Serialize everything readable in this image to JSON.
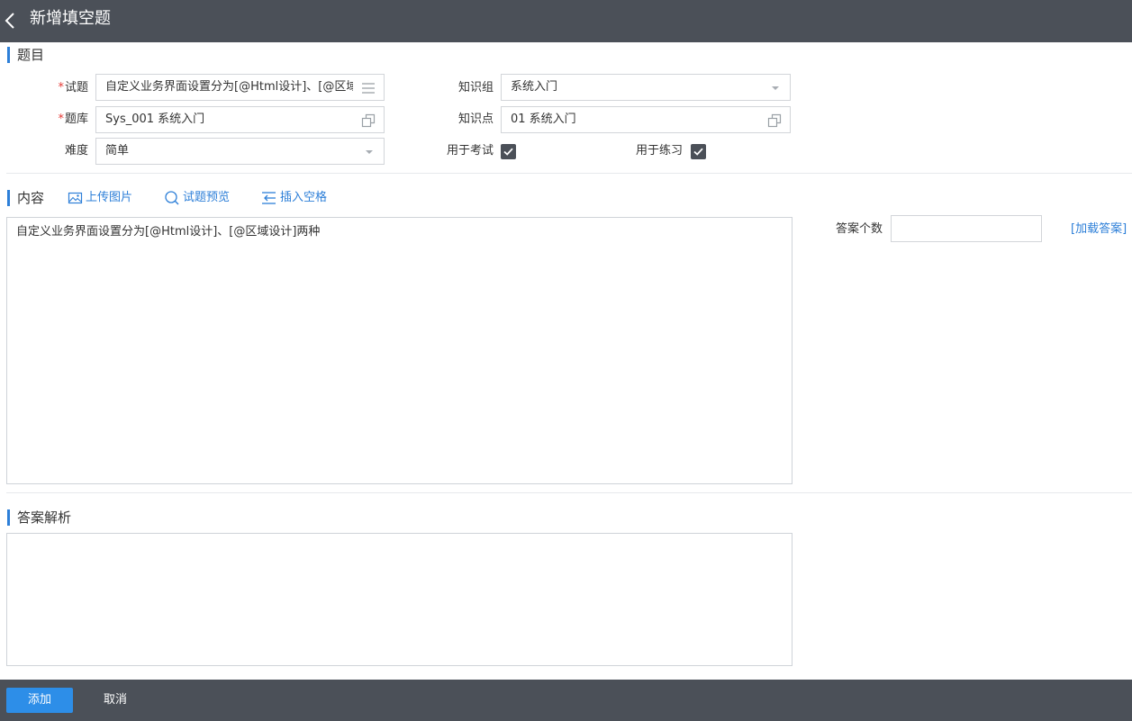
{
  "header": {
    "title": "新增填空题"
  },
  "question_section": {
    "title": "题目",
    "question": {
      "label": "试题",
      "required": true,
      "value": "自定义业务界面设置分为[@Html设计]、[@区域i"
    },
    "bank": {
      "label": "题库",
      "required": true,
      "value": "Sys_001 系统入门"
    },
    "difficulty": {
      "label": "难度",
      "value": "简单"
    },
    "knowledge_group": {
      "label": "知识组",
      "value": "系统入门"
    },
    "knowledge_point": {
      "label": "知识点",
      "value": "01 系统入门"
    },
    "for_exam": {
      "label": "用于考试",
      "checked": true
    },
    "for_practice": {
      "label": "用于练习",
      "checked": true
    }
  },
  "content_section": {
    "title": "内容",
    "upload_image": "上传图片",
    "preview": "试题预览",
    "insert_blank": "插入空格",
    "text": "自定义业务界面设置分为[@Html设计]、[@区域设计]两种",
    "answer_count_label": "答案个数",
    "answer_count_value": "",
    "load_answers": "[加载答案]"
  },
  "analysis_section": {
    "title": "答案解析",
    "text": ""
  },
  "footer": {
    "add_label": "添加",
    "cancel_label": "取消"
  },
  "colors": {
    "header_bg": "#4b5058",
    "accent": "#2d7fd8",
    "primary_button": "#2d8ee8",
    "required": "#e53935"
  },
  "icons": [
    "chevron-left-icon",
    "list-icon",
    "copy-icon",
    "dropdown-caret-icon",
    "checkbox-checked-icon",
    "image-icon",
    "search-icon",
    "insert-blank-icon"
  ]
}
